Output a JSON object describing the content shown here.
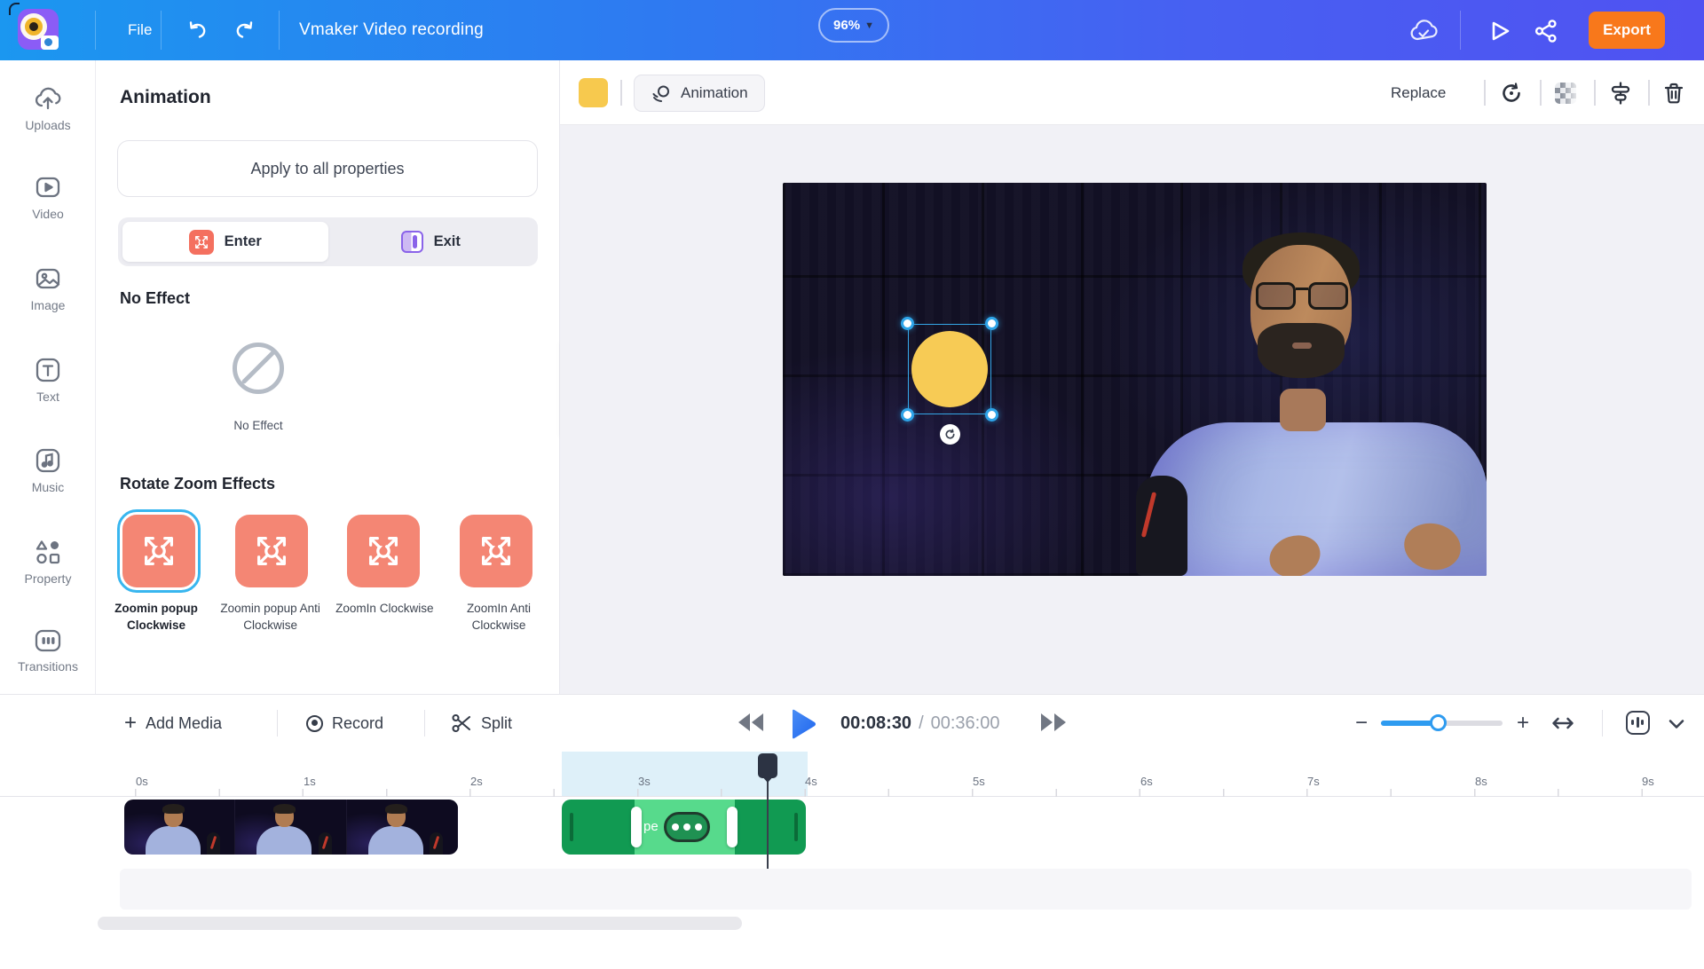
{
  "topbar": {
    "file_menu": "File",
    "document_title": "Vmaker Video recording",
    "zoom_level": "96%",
    "export_label": "Export"
  },
  "sidebar": {
    "items": [
      {
        "label": "Uploads"
      },
      {
        "label": "Video"
      },
      {
        "label": "Image"
      },
      {
        "label": "Text"
      },
      {
        "label": "Music"
      },
      {
        "label": "Property"
      },
      {
        "label": "Transitions"
      }
    ]
  },
  "animation_panel": {
    "title": "Animation",
    "apply_button": "Apply to all properties",
    "enter_tab": "Enter",
    "exit_tab": "Exit",
    "no_effect_heading": "No Effect",
    "no_effect_label": "No Effect",
    "rotate_heading": "Rotate Zoom Effects",
    "effects": [
      {
        "label": "Zoomin popup Clockwise",
        "selected": true
      },
      {
        "label": "Zoomin popup Anti Clockwise",
        "selected": false
      },
      {
        "label": "ZoomIn Clockwise",
        "selected": false
      },
      {
        "label": "ZoomIn Anti Clockwise",
        "selected": false
      }
    ]
  },
  "canvas_toolbar": {
    "animation_button": "Animation",
    "replace_button": "Replace"
  },
  "timeline": {
    "add_media": "Add Media",
    "record": "Record",
    "split": "Split",
    "current_time": "00:08:30",
    "time_separator": "/",
    "total_time": "00:36:00",
    "ruler_labels": [
      "0s",
      "1s",
      "2s",
      "3s",
      "4s",
      "5s",
      "6s",
      "7s",
      "8s",
      "9s"
    ],
    "green_clip_text": "pe"
  },
  "colors": {
    "accent_blue": "#2e9bf0",
    "topbar_gradient_start": "#1b97f0",
    "topbar_gradient_end": "#5052f2",
    "export_orange": "#f8781b",
    "effect_salmon": "#f48674",
    "selection_blue": "#35a7e8",
    "clip_green": "#119a52",
    "clip_green_light": "#57da8c",
    "shape_yellow": "#f7cb55"
  }
}
